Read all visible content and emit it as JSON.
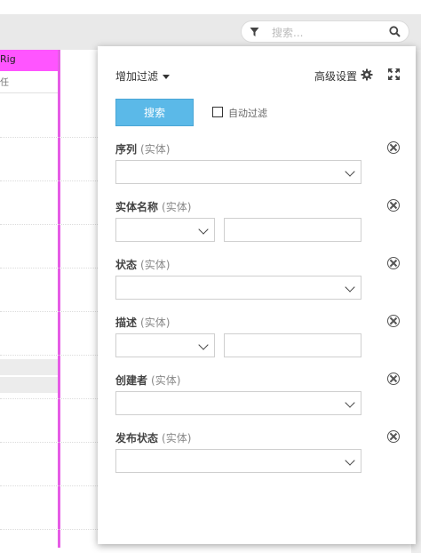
{
  "search": {
    "placeholder": "搜索..."
  },
  "table": {
    "column_header": "Rig",
    "column_subheader": "任"
  },
  "filter_panel": {
    "add_filter_label": "增加过滤",
    "advanced_settings_label": "高级设置",
    "search_button_label": "搜索",
    "auto_filter_label": "自动过滤",
    "entity_suffix": "(实体)",
    "fields": [
      {
        "label": "序列",
        "type": "select"
      },
      {
        "label": "实体名称",
        "type": "select+text"
      },
      {
        "label": "状态",
        "type": "select"
      },
      {
        "label": "描述",
        "type": "select+text"
      },
      {
        "label": "创建者",
        "type": "select"
      },
      {
        "label": "发布状态",
        "type": "select"
      }
    ]
  },
  "icons": {
    "filter": "filter-icon",
    "search": "search-icon",
    "gear": "gear-icon",
    "expand": "expand-icon",
    "remove": "remove-circle-icon",
    "chevron": "chevron-down-icon"
  },
  "colors": {
    "accent": "#5bb9e8",
    "column_highlight": "#ff55ff"
  }
}
